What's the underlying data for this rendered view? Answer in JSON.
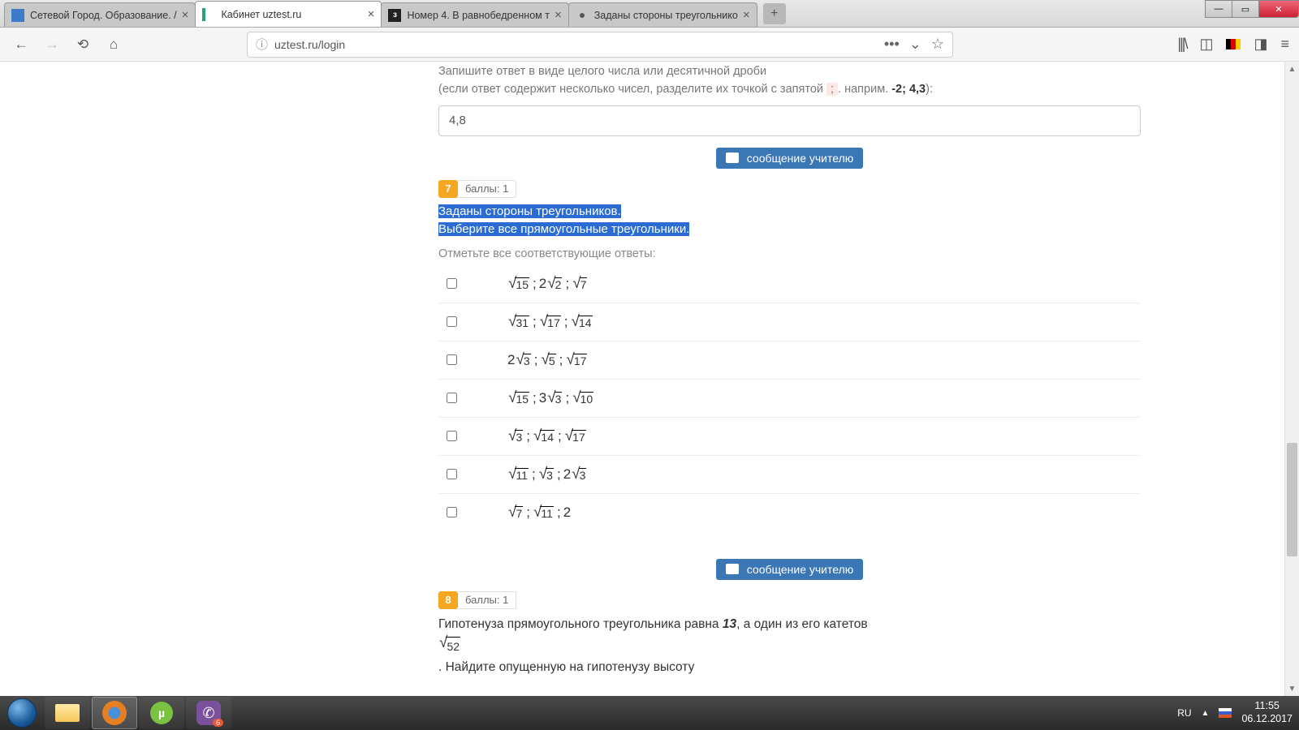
{
  "tabs": [
    {
      "label": "Сетевой Город. Образование. /"
    },
    {
      "label": "Кабинет uztest.ru"
    },
    {
      "label": "Номер 4. В равнобедренном т"
    },
    {
      "label": "Заданы стороны треугольнико"
    }
  ],
  "url": "uztest.ru/login",
  "q6": {
    "hint_a": "Запишите ответ в виде целого числа или десятичной дроби",
    "hint_b_pre": "(если ответ содержит несколько чисел, разделите их точкой с запятой ",
    "hint_b_sep": ";",
    "hint_b_mid": ". наприм. ",
    "hint_b_ex": "-2; 4,3",
    "hint_b_post": "):",
    "value": "4,8"
  },
  "msg_label": "сообщение   учителю",
  "q7": {
    "num": "7",
    "points": "баллы: 1",
    "line1": "Заданы стороны треугольников.",
    "line2": "Выберите все прямоугольные треугольники.",
    "instruct": "Отметьте все соответствующие ответы:",
    "options": [
      {
        "t": [
          [
            "",
            "15"
          ],
          [
            "2",
            "2"
          ],
          [
            "",
            "7"
          ]
        ]
      },
      {
        "t": [
          [
            "",
            "31"
          ],
          [
            "",
            "17"
          ],
          [
            "",
            "14"
          ]
        ]
      },
      {
        "t": [
          [
            "2",
            "3"
          ],
          [
            "",
            "5"
          ],
          [
            "",
            "17"
          ]
        ]
      },
      {
        "t": [
          [
            "",
            "15"
          ],
          [
            "3",
            "3"
          ],
          [
            "",
            "10"
          ]
        ]
      },
      {
        "t": [
          [
            "",
            "3"
          ],
          [
            "",
            "14"
          ],
          [
            "",
            "17"
          ]
        ]
      },
      {
        "t": [
          [
            "",
            "11"
          ],
          [
            "",
            "3"
          ],
          [
            "2",
            "3"
          ]
        ]
      },
      {
        "t": [
          [
            "",
            "7"
          ],
          [
            "",
            "11"
          ]
        ],
        "last": "2"
      }
    ]
  },
  "q8": {
    "num": "8",
    "points": "баллы: 1",
    "text_a": "Гипотенуза прямоугольного треугольника равна ",
    "hyp": "13",
    "text_b": ", а один из его катетов ",
    "leg": "52",
    "text_c": ". Найдите опущенную на гипотенузу высоту"
  },
  "tray": {
    "lang": "RU",
    "time": "11:55",
    "date": "06.12.2017"
  }
}
